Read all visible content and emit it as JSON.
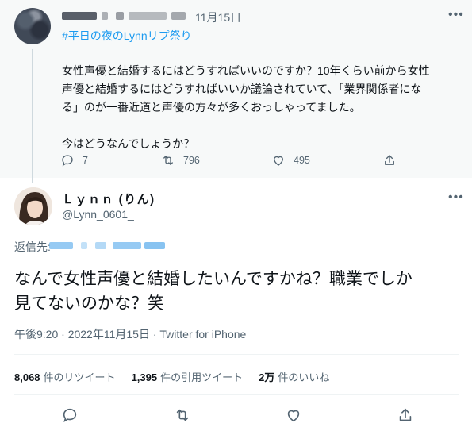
{
  "parent_tweet": {
    "date": "11月15日",
    "hashtag": "#平日の夜のLynnリプ祭り",
    "text_lines": [
      "女性声優と結婚するにはどうすればいいのですか？10年くらい前から女性",
      "声優と結婚するにはどうすればいいか議論されていて、「業界関係者にな",
      "る」のが一番近道と声優の方々が多くおっしゃってました。",
      "",
      "今はどうなんでしょうか？"
    ],
    "replies": "7",
    "retweets": "796",
    "likes": "495"
  },
  "main_tweet": {
    "display_name": "Ｌｙｎｎ (りん)",
    "handle": "@Lynn_0601_",
    "reply_to_label": "返信先:",
    "text_lines": [
      "なんで女性声優と結婚したいんですかね？職業でしか",
      "見てないのかな？笑"
    ],
    "meta": "午後9:20 · 2022年11月15日 · Twitter for iPhone",
    "stats": [
      {
        "value": "8,068",
        "label": "件のリツイート"
      },
      {
        "value": "1,395",
        "label": "件の引用ツイート"
      },
      {
        "value": "2万",
        "label": "件のいいね"
      }
    ]
  },
  "icons": {
    "more": "more-icon",
    "reply": "reply-icon",
    "retweet": "retweet-icon",
    "like": "heart-icon",
    "share": "share-icon"
  },
  "colors": {
    "accent": "#1d9bf0",
    "muted": "#536471",
    "text": "#0f1419",
    "parent_bg": "#f7f9f9"
  }
}
